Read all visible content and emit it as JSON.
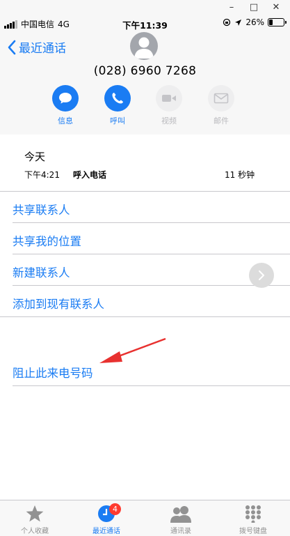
{
  "window_controls": {
    "minimize": "–",
    "maximize": "□",
    "close": "✕"
  },
  "status_bar": {
    "carrier": "中国电信",
    "network": "4G",
    "time": "下午11:39",
    "battery_percent": "26%",
    "battery_level": 0.26
  },
  "header": {
    "back_label": "最近通话",
    "phone_number": "(028) 6960 7268",
    "actions": [
      {
        "label": "信息",
        "icon": "message-icon",
        "enabled": true
      },
      {
        "label": "呼叫",
        "icon": "phone-icon",
        "enabled": true
      },
      {
        "label": "视频",
        "icon": "video-icon",
        "enabled": false
      },
      {
        "label": "邮件",
        "icon": "mail-icon",
        "enabled": false
      }
    ]
  },
  "call_log": {
    "day": "今天",
    "entries": [
      {
        "time": "下午4:21",
        "type": "呼入电话",
        "duration": "11 秒钟"
      }
    ]
  },
  "options": [
    "共享联系人",
    "共享我的位置",
    "新建联系人",
    "添加到现有联系人"
  ],
  "block_label": "阻止此来电号码",
  "tab_bar": {
    "tabs": [
      {
        "label": "个人收藏",
        "icon": "star-icon",
        "active": false
      },
      {
        "label": "最近通话",
        "icon": "clock-icon",
        "active": true,
        "badge": "4"
      },
      {
        "label": "通讯录",
        "icon": "contacts-icon",
        "active": false
      },
      {
        "label": "拨号键盘",
        "icon": "keypad-icon",
        "active": false
      }
    ]
  },
  "colors": {
    "accent": "#1a7cf3",
    "disabled": "#b9b9bd",
    "badge": "#ff3b30",
    "annotation_arrow": "#e8312f"
  }
}
